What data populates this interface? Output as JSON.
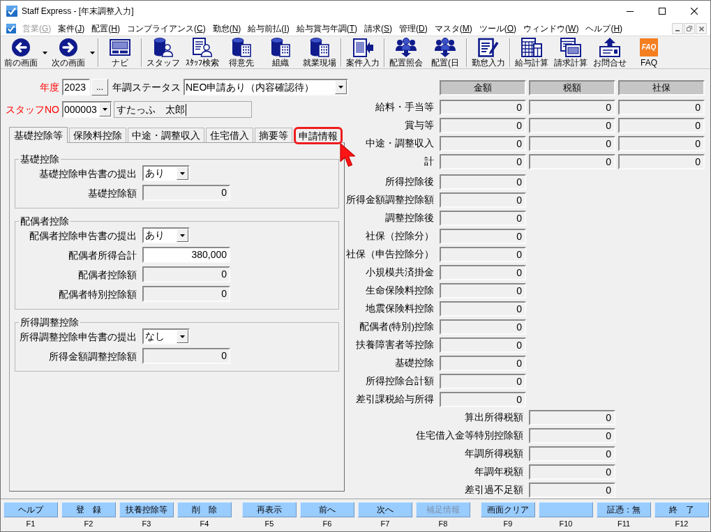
{
  "window": {
    "title": "Staff Express - [年末調整入力]"
  },
  "menu": [
    {
      "before": "営業(",
      "mnemonic": "G",
      "after": ")",
      "disabled": true
    },
    {
      "before": "案件(",
      "mnemonic": "J",
      "after": ")",
      "disabled": false
    },
    {
      "before": "配置(",
      "mnemonic": "H",
      "after": ")",
      "disabled": false
    },
    {
      "before": "コンプライアンス(",
      "mnemonic": "C",
      "after": ")",
      "disabled": false
    },
    {
      "before": "勤怠(",
      "mnemonic": "N",
      "after": ")",
      "disabled": false
    },
    {
      "before": "給与前払(",
      "mnemonic": "I",
      "after": ")",
      "disabled": false
    },
    {
      "before": "給与賞与年調(",
      "mnemonic": "T",
      "after": ")",
      "disabled": false
    },
    {
      "before": "請求(",
      "mnemonic": "S",
      "after": ")",
      "disabled": false
    },
    {
      "before": "管理(",
      "mnemonic": "D",
      "after": ")",
      "disabled": false
    },
    {
      "before": "マスタ(",
      "mnemonic": "M",
      "after": ")",
      "disabled": false
    },
    {
      "before": "ツール(",
      "mnemonic": "O",
      "after": ")",
      "disabled": false
    },
    {
      "before": "ウィンドウ(",
      "mnemonic": "W",
      "after": ")",
      "disabled": false
    },
    {
      "before": "ヘルプ(",
      "mnemonic": "H",
      "after": ")",
      "disabled": false
    }
  ],
  "toolbar": [
    {
      "items": [
        {
          "label": "前の画面",
          "kind": "back",
          "dropdown": true
        },
        {
          "label": "次の画面",
          "kind": "forward",
          "dropdown": true
        }
      ]
    },
    {
      "items": [
        {
          "label": "ナビ",
          "kind": "keyboard",
          "dropdown": false
        }
      ]
    },
    {
      "items": [
        {
          "label": "スタッフ",
          "kind": "staff",
          "dropdown": false
        },
        {
          "label": "ｽﾀｯﾌ検索",
          "kind": "search",
          "dropdown": false
        },
        {
          "label": "得意先",
          "kind": "building",
          "dropdown": false
        },
        {
          "label": "組織",
          "kind": "building",
          "dropdown": false
        },
        {
          "label": "就業現場",
          "kind": "building",
          "dropdown": false
        }
      ]
    },
    {
      "items": [
        {
          "label": "案件入力",
          "kind": "entry",
          "dropdown": false
        }
      ]
    },
    {
      "items": [
        {
          "label": "配置照会",
          "kind": "people",
          "dropdown": false
        },
        {
          "label": "配置(日",
          "kind": "people",
          "dropdown": false
        }
      ]
    },
    {
      "items": [
        {
          "label": "勤怠入力",
          "kind": "edit",
          "dropdown": false
        }
      ]
    },
    {
      "items": [
        {
          "label": "給与計算",
          "kind": "calc",
          "dropdown": false
        },
        {
          "label": "請求計算",
          "kind": "sheet",
          "dropdown": false
        },
        {
          "label": "お問合せ",
          "kind": "upload",
          "dropdown": false
        },
        {
          "label": "FAQ",
          "kind": "logo",
          "badge": "FAQ",
          "dropdown": false
        }
      ]
    }
  ],
  "header": {
    "year": {
      "label": "年度",
      "value": "2023",
      "button": "..."
    },
    "status": {
      "label": "年調ステータス",
      "value": "NEO申請あり（内容確認待）"
    },
    "staff": {
      "label": "スタッフNO",
      "value": "000003",
      "name": "すたっふ　太郎",
      "focused": true
    }
  },
  "tabs": [
    {
      "label": "基礎控除等",
      "selected": true,
      "highlighted": false
    },
    {
      "label": "保険料控除",
      "selected": false,
      "highlighted": false
    },
    {
      "label": "中途・調整収入",
      "selected": false,
      "highlighted": false
    },
    {
      "label": "住宅借入",
      "selected": false,
      "highlighted": false
    },
    {
      "label": "摘要等",
      "selected": false,
      "highlighted": false
    },
    {
      "label": "申請情報",
      "selected": false,
      "highlighted": true
    }
  ],
  "groups": [
    {
      "title": "基礎控除",
      "rows": [
        {
          "label": "基礎控除申告書の提出",
          "kind": "select",
          "value": "あり"
        },
        {
          "label": "基礎控除額",
          "kind": "readonly",
          "value": "0"
        }
      ]
    },
    {
      "title": "配偶者控除",
      "rows": [
        {
          "label": "配偶者控除申告書の提出",
          "kind": "select",
          "value": "あり"
        },
        {
          "label": "配偶者所得合計",
          "kind": "input",
          "value": "380,000"
        },
        {
          "label": "配偶者控除額",
          "kind": "readonly",
          "value": "0"
        },
        {
          "label": "配偶者特別控除額",
          "kind": "readonly",
          "value": "0"
        }
      ]
    },
    {
      "title": "所得調整控除",
      "rows": [
        {
          "label": "所得調整控除申告書の提出",
          "kind": "select",
          "value": "なし"
        },
        {
          "label": "所得金額調整控除額",
          "kind": "readonly",
          "value": "0"
        }
      ]
    }
  ],
  "summary": {
    "columns": [
      "金額",
      "税額",
      "社保"
    ],
    "income_rows": [
      {
        "label": "給料・手当等",
        "values": [
          "0",
          "0",
          "0"
        ]
      },
      {
        "label": "賞与等",
        "values": [
          "0",
          "0",
          "0"
        ]
      },
      {
        "label": "中途・調整収入",
        "values": [
          "0",
          "0",
          "0"
        ]
      },
      {
        "label": "計",
        "values": [
          "0",
          "0",
          "0"
        ]
      }
    ],
    "deduction_rows": [
      {
        "label": "所得控除後",
        "value": "0"
      },
      {
        "label": "所得金額調整控除額",
        "value": "0"
      },
      {
        "label": "調整控除後",
        "value": "0"
      },
      {
        "label": "社保（控除分）",
        "value": "0"
      },
      {
        "label": "社保（申告控除分）",
        "value": "0"
      },
      {
        "label": "小規模共済掛金",
        "value": "0"
      },
      {
        "label": "生命保険料控除",
        "value": "0"
      },
      {
        "label": "地震保険料控除",
        "value": "0"
      },
      {
        "label": "配偶者(特別)控除",
        "value": "0"
      },
      {
        "label": "扶養障害者等控除",
        "value": "0"
      },
      {
        "label": "基礎控除",
        "value": "0"
      },
      {
        "label": "所得控除合計額",
        "value": "0"
      },
      {
        "label": "差引課税給与所得",
        "value": "0"
      }
    ],
    "tax_rows": [
      {
        "label": "算出所得税額",
        "value": "0"
      },
      {
        "label": "住宅借入金等特別控除額",
        "value": "0"
      },
      {
        "label": "年調所得税額",
        "value": "0"
      },
      {
        "label": "年調年税額",
        "value": "0"
      },
      {
        "label": "差引過不足額",
        "value": "0"
      }
    ]
  },
  "function_keys": [
    {
      "keys": [
        {
          "label": "ヘルプ",
          "key": "F1",
          "disabled": false
        },
        {
          "label": "登　録",
          "key": "F2",
          "disabled": false
        },
        {
          "label": "扶養控除等",
          "key": "F3",
          "disabled": false
        },
        {
          "label": "削　除",
          "key": "F4",
          "disabled": false
        }
      ]
    },
    {
      "keys": [
        {
          "label": "再表示",
          "key": "F5",
          "disabled": false
        },
        {
          "label": "前へ",
          "key": "F6",
          "disabled": false
        },
        {
          "label": "次へ",
          "key": "F7",
          "disabled": false
        },
        {
          "label": "補足情報",
          "key": "F8",
          "disabled": true
        }
      ]
    },
    {
      "keys": [
        {
          "label": "画面クリア",
          "key": "F9",
          "disabled": false
        },
        {
          "key": "F10"
        },
        {
          "label": "証憑：無",
          "key": "F11",
          "disabled": false
        },
        {
          "label": "終　了",
          "key": "F12",
          "disabled": false
        }
      ]
    }
  ]
}
